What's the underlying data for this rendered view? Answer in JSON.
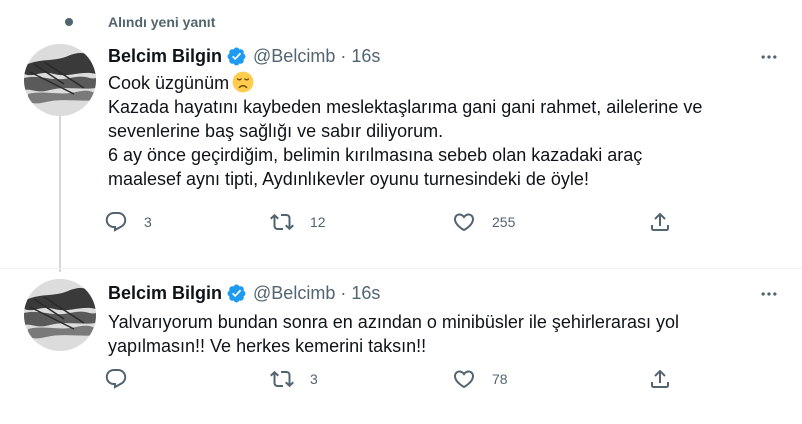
{
  "social_context": {
    "text": "Alındı yeni yanıt"
  },
  "tweets": [
    {
      "author": {
        "name": "Belcim Bilgin",
        "handle": "@Belcimb",
        "verified": true
      },
      "separator": "·",
      "time": "16s",
      "body_lines": [
        "Cook üzgünüm",
        "Kazada hayatını kaybeden meslektaşlarıma gani gani rahmet, ailelerine ve",
        "sevenlerine baş sağlığı ve sabır diliyorum.",
        "6 ay önce geçirdiğim, belimin kırılmasına sebeb olan  kazadaki araç",
        "maalesef aynı tipti, Aydınlıkevler oyunu turnesindeki de öyle!"
      ],
      "emoji": "disappointed-face",
      "replies": "3",
      "retweets": "12",
      "likes": "255"
    },
    {
      "author": {
        "name": "Belcim Bilgin",
        "handle": "@Belcimb",
        "verified": true
      },
      "separator": "·",
      "time": "16s",
      "body_lines": [
        "Yalvarıyorum bundan sonra en azından o minibüsler ile şehirlerarası yol",
        "yapılmasın!! Ve herkes kemerini taksın!!"
      ],
      "replies": "",
      "retweets": "3",
      "likes": "78"
    }
  ],
  "colors": {
    "text": "#0f1419",
    "muted": "#536471",
    "verified": "#1d9bf0",
    "divider": "#eff3f4",
    "thread_line": "#cfd9de"
  },
  "icons": {
    "reply": "reply-icon",
    "retweet": "retweet-icon",
    "like": "heart-icon",
    "share": "share-icon",
    "more": "more-icon",
    "verified": "verified-badge-icon"
  }
}
